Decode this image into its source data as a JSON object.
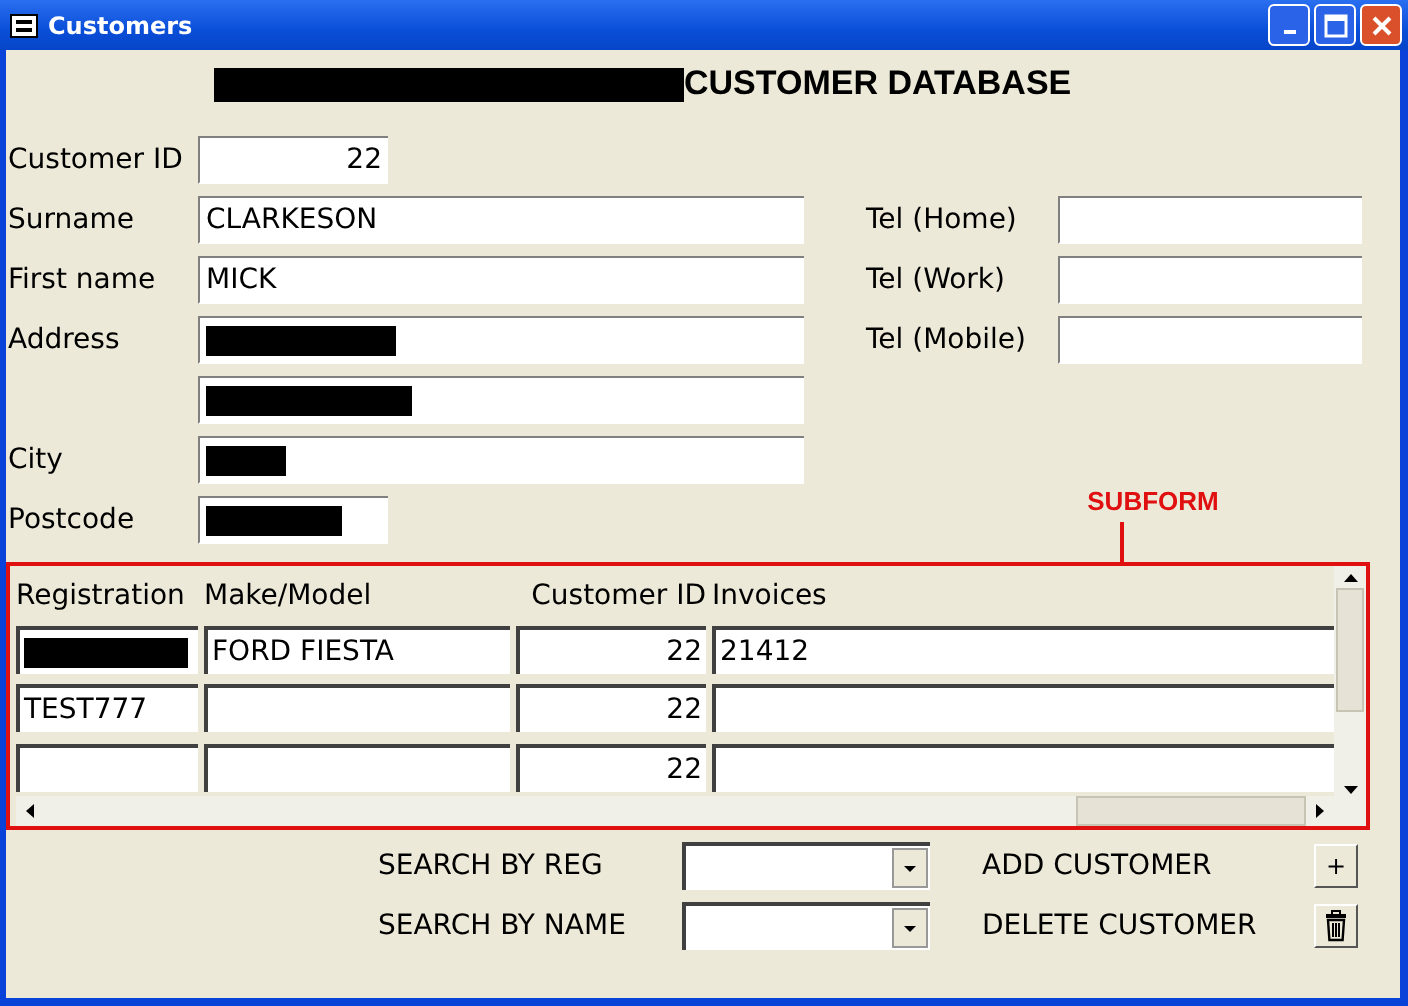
{
  "window": {
    "title": "Customers"
  },
  "heading": {
    "redacted": true,
    "text": "CUSTOMER DATABASE"
  },
  "fields": [
    {
      "label": "Customer ID",
      "value": "22",
      "redacted": false
    },
    {
      "label": "Surname",
      "value": "CLARKESON",
      "redacted": false
    },
    {
      "label": "First name",
      "value": "MICK",
      "redacted": false
    },
    {
      "label": "Address",
      "redacted": true
    },
    {
      "redacted": true
    },
    {
      "label": "City",
      "redacted": true
    },
    {
      "label": "Postcode",
      "redacted": true
    }
  ],
  "phones": [
    {
      "label": "Tel (Home)"
    },
    {
      "label": "Tel (Work)"
    },
    {
      "label": "Tel (Mobile)"
    }
  ],
  "subform": {
    "label": "SUBFORM",
    "columns": [
      "Registration",
      "Make/Model",
      "Customer ID",
      "Invoices"
    ],
    "rows": [
      {
        "registration": "",
        "registration_redacted": true,
        "make_model": "FORD FIESTA",
        "customer_id": "22",
        "invoices": "21412"
      },
      {
        "registration": "TEST777",
        "registration_redacted": false,
        "make_model": "",
        "customer_id": "22",
        "invoices": ""
      },
      {
        "registration": "",
        "registration_redacted": false,
        "make_model": "",
        "customer_id": "22",
        "invoices": ""
      }
    ]
  },
  "search": [
    {
      "label": "SEARCH BY REG"
    },
    {
      "label": "SEARCH BY NAME"
    }
  ],
  "actions": [
    {
      "label": "ADD CUSTOMER",
      "kind": "add",
      "button": "+"
    },
    {
      "label": "DELETE CUSTOMER",
      "kind": "delete"
    }
  ]
}
